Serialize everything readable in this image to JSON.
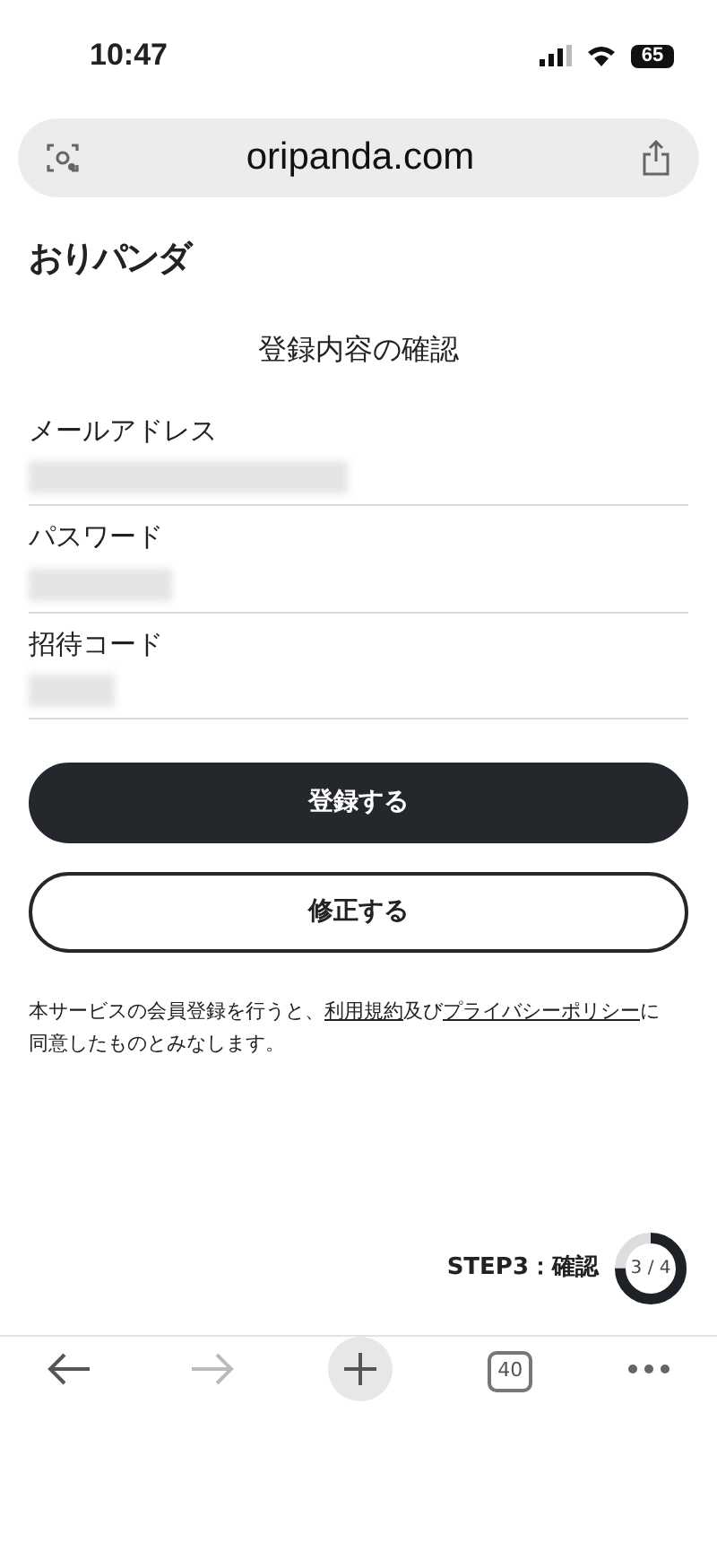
{
  "status_bar": {
    "time": "10:47",
    "battery": "65"
  },
  "browser": {
    "url": "oripanda.com",
    "tab_count": "40"
  },
  "logo": "おりパンダ",
  "title": "登録内容の確認",
  "fields": [
    {
      "label": "メールアドレス"
    },
    {
      "label": "パスワード"
    },
    {
      "label": "招待コード"
    }
  ],
  "buttons": [
    {
      "label": "登録する",
      "kind": "primary"
    },
    {
      "label": "修正する",
      "kind": "outline"
    }
  ],
  "notice_parts": [
    "本サービスの会員登録を行うと、",
    "利用規約",
    "及び",
    "プライバシーポリシー",
    "に同意したものとみなします。"
  ],
  "step": {
    "label": "STEP3：確認",
    "progress": "3 / 4",
    "level": 0.75
  }
}
